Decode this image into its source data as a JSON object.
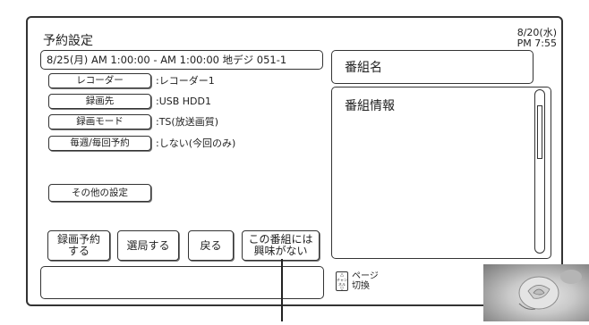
{
  "header": {
    "title": "予約設定",
    "date": "8/20(水)",
    "time": "PM 7:55"
  },
  "recording": {
    "info_line": "8/25(月) AM 1:00:00 - AM 1:00:00 地デジ 051-1",
    "rows": [
      {
        "button": "レコーダー",
        "value": ":レコーダー1"
      },
      {
        "button": "録画先",
        "value": ":USB HDD1"
      },
      {
        "button": "録画モード",
        "value": ":TS(放送画質)"
      },
      {
        "button": "毎週/毎回予約",
        "value": ":しない(今回のみ)"
      }
    ],
    "other_settings_label": "その他の設定"
  },
  "bottom_buttons": {
    "reserve_line1": "録画予約",
    "reserve_line2": "する",
    "select_station": "選局する",
    "back": "戻る",
    "not_interested_line1": "この番組には",
    "not_interested_line2": "興味がない"
  },
  "program": {
    "name_label": "番組名",
    "info_label": "番組情報"
  },
  "page_hint": {
    "key_label": "チャンネル",
    "line1": "ページ",
    "line2": "切換"
  }
}
